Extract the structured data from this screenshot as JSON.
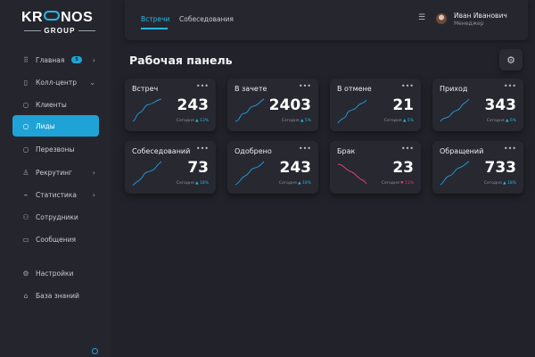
{
  "brand": {
    "logo_top_1": "KR",
    "logo_top_2": "NOS",
    "logo_bottom": "GROUP"
  },
  "sidebar": {
    "items": [
      {
        "label": "Главная",
        "icon": "grid-icon",
        "badge": "5"
      },
      {
        "label": "Колл-центр",
        "icon": "phone-icon"
      },
      {
        "label": "Клиенты",
        "icon": "circle-icon"
      },
      {
        "label": "Лиды",
        "icon": "circle-icon",
        "active": true
      },
      {
        "label": "Перезвоны",
        "icon": "circle-icon"
      },
      {
        "label": "Рекрутинг",
        "icon": "user-icon"
      },
      {
        "label": "Статистика",
        "icon": "chart-icon"
      },
      {
        "label": "Сотрудники",
        "icon": "users-icon"
      },
      {
        "label": "Сообщения",
        "icon": "message-icon"
      },
      {
        "label": "Настройки",
        "icon": "settings-icon"
      },
      {
        "label": "База знаний",
        "icon": "book-icon"
      }
    ]
  },
  "header": {
    "tabs": [
      {
        "label": "Встречи",
        "active": true
      },
      {
        "label": "Собеседования"
      }
    ],
    "user": {
      "name": "Иван Иванович",
      "role": "Менеджер"
    }
  },
  "main": {
    "title": "Рабочая панель",
    "cards": [
      {
        "title": "Встреч",
        "value": "243",
        "foot_label": "Сегодня",
        "trend": "▲ 13%",
        "trend_dir": "up",
        "color": "#2196d6"
      },
      {
        "title": "В зачете",
        "value": "2403",
        "foot_label": "Сегодня",
        "trend": "▲ 5%",
        "trend_dir": "up",
        "color": "#2196d6"
      },
      {
        "title": "В отмене",
        "value": "21",
        "foot_label": "Сегодня",
        "trend": "▲ 5%",
        "trend_dir": "up",
        "color": "#2196d6"
      },
      {
        "title": "Приход",
        "value": "343",
        "foot_label": "Сегодня",
        "trend": "▲ 6%",
        "trend_dir": "up",
        "color": "#2196d6"
      },
      {
        "title": "Собеседований",
        "value": "73",
        "foot_label": "Сегодня",
        "trend": "▲ 18%",
        "trend_dir": "up",
        "color": "#2196d6"
      },
      {
        "title": "Одобрено",
        "value": "243",
        "foot_label": "Сегодня",
        "trend": "▲ 18%",
        "trend_dir": "up",
        "color": "#2196d6"
      },
      {
        "title": "Брак",
        "value": "23",
        "foot_label": "Сегодня",
        "trend": "▼ 11%",
        "trend_dir": "down",
        "color": "#e0407a"
      },
      {
        "title": "Обращений",
        "value": "733",
        "foot_label": "Сегодня",
        "trend": "▲ 18%",
        "trend_dir": "up",
        "color": "#2196d6"
      }
    ]
  }
}
